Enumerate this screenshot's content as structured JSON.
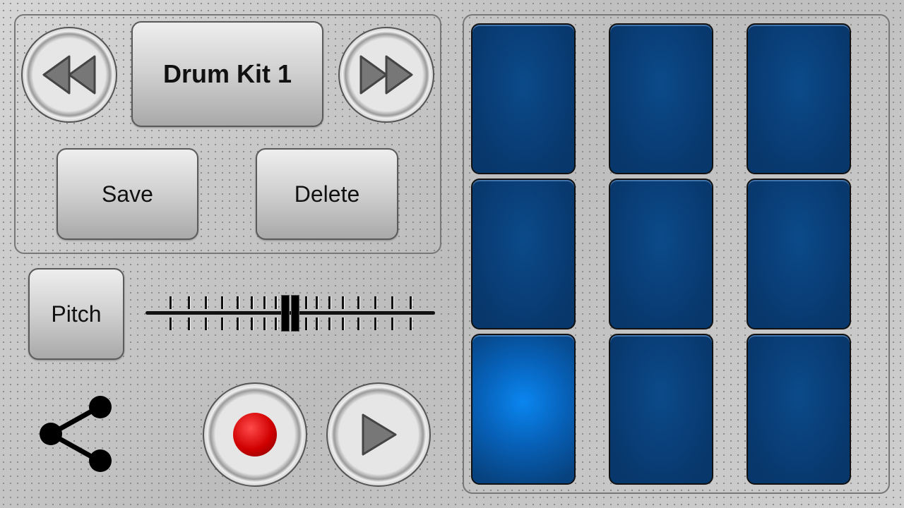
{
  "kit": {
    "name": "Drum Kit 1",
    "previous_icon": "rewind-icon",
    "next_icon": "fast-forward-icon"
  },
  "actions": {
    "save": "Save",
    "delete": "Delete"
  },
  "pitch": {
    "label": "Pitch",
    "value": 0.5
  },
  "transport": {
    "record_icon": "record-icon",
    "play_icon": "play-icon",
    "share_icon": "share-icon"
  },
  "pads": {
    "count": 9,
    "active_index": 6
  },
  "colors": {
    "pad": "#08376b",
    "pad_active": "#0a86f0",
    "record": "#d00000"
  }
}
